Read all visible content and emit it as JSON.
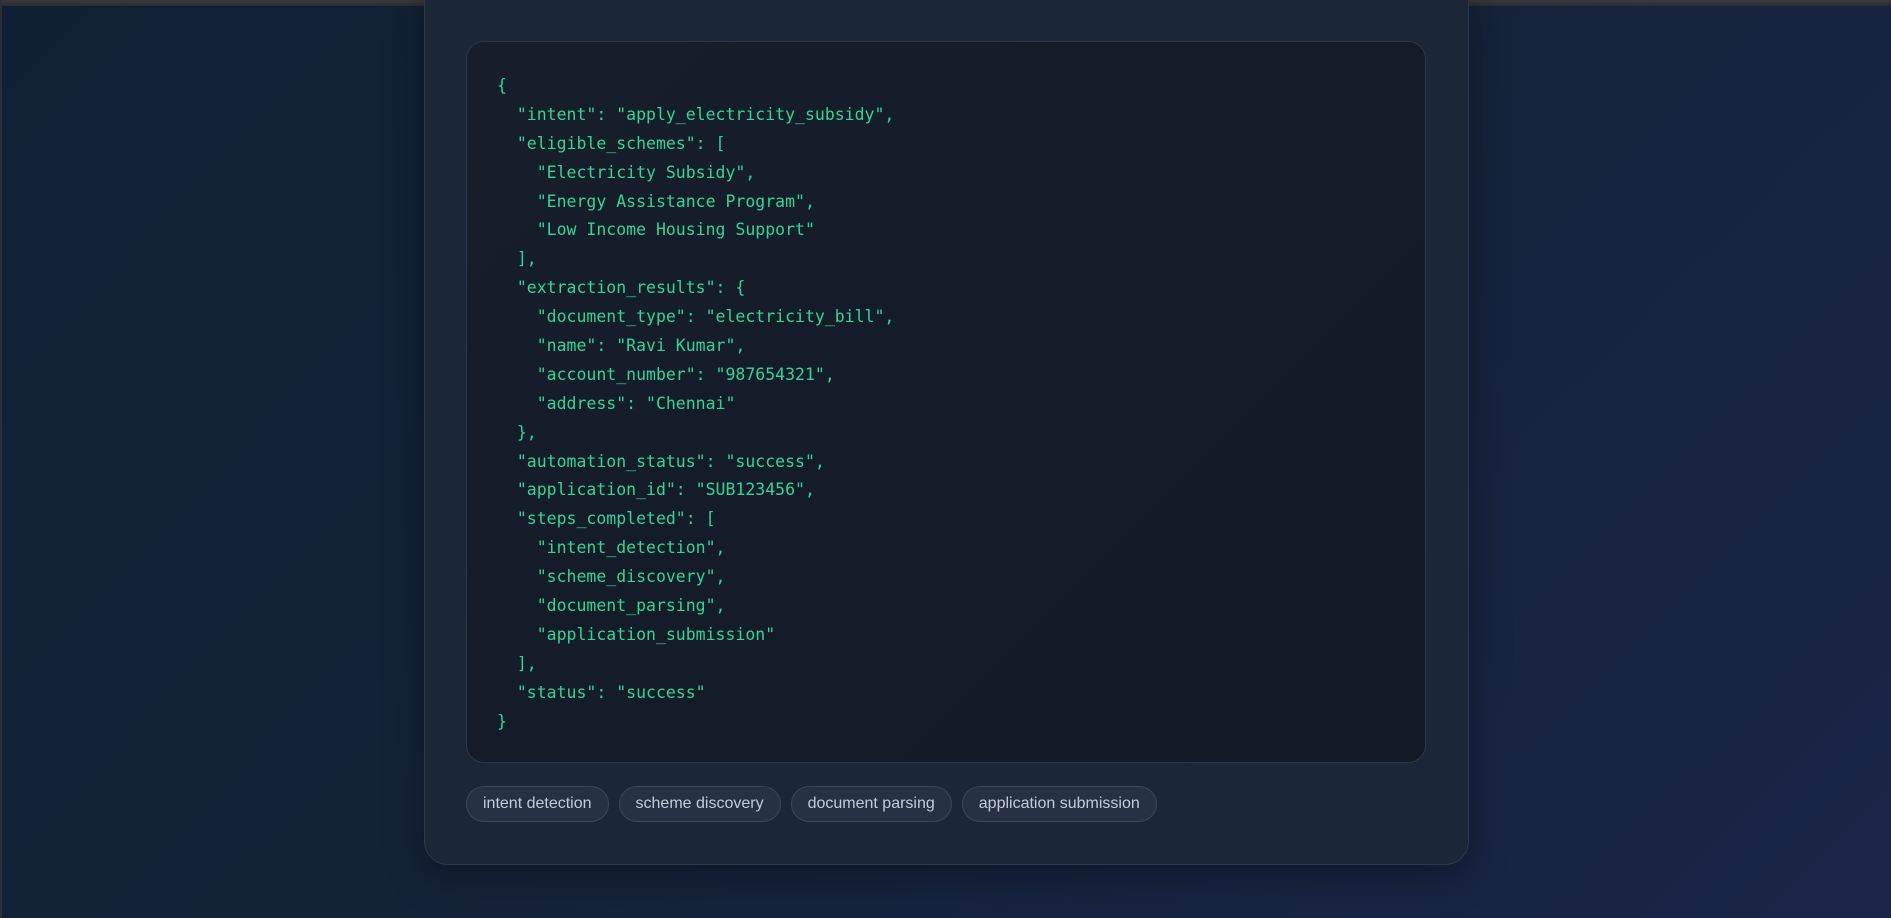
{
  "code_output": {
    "lines": [
      "{",
      "  \"intent\": \"apply_electricity_subsidy\",",
      "  \"eligible_schemes\": [",
      "    \"Electricity Subsidy\",",
      "    \"Energy Assistance Program\",",
      "    \"Low Income Housing Support\"",
      "  ],",
      "  \"extraction_results\": {",
      "    \"document_type\": \"electricity_bill\",",
      "    \"name\": \"Ravi Kumar\",",
      "    \"account_number\": \"987654321\",",
      "    \"address\": \"Chennai\"",
      "  },",
      "  \"automation_status\": \"success\",",
      "  \"application_id\": \"SUB123456\",",
      "  \"steps_completed\": [",
      "    \"intent_detection\",",
      "    \"scheme_discovery\",",
      "    \"document_parsing\",",
      "    \"application_submission\"",
      "  ],",
      "  \"status\": \"success\"",
      "}"
    ],
    "text_color": "#34d399"
  },
  "steps": [
    {
      "label": "intent detection"
    },
    {
      "label": "scheme discovery"
    },
    {
      "label": "document parsing"
    },
    {
      "label": "application submission"
    }
  ]
}
